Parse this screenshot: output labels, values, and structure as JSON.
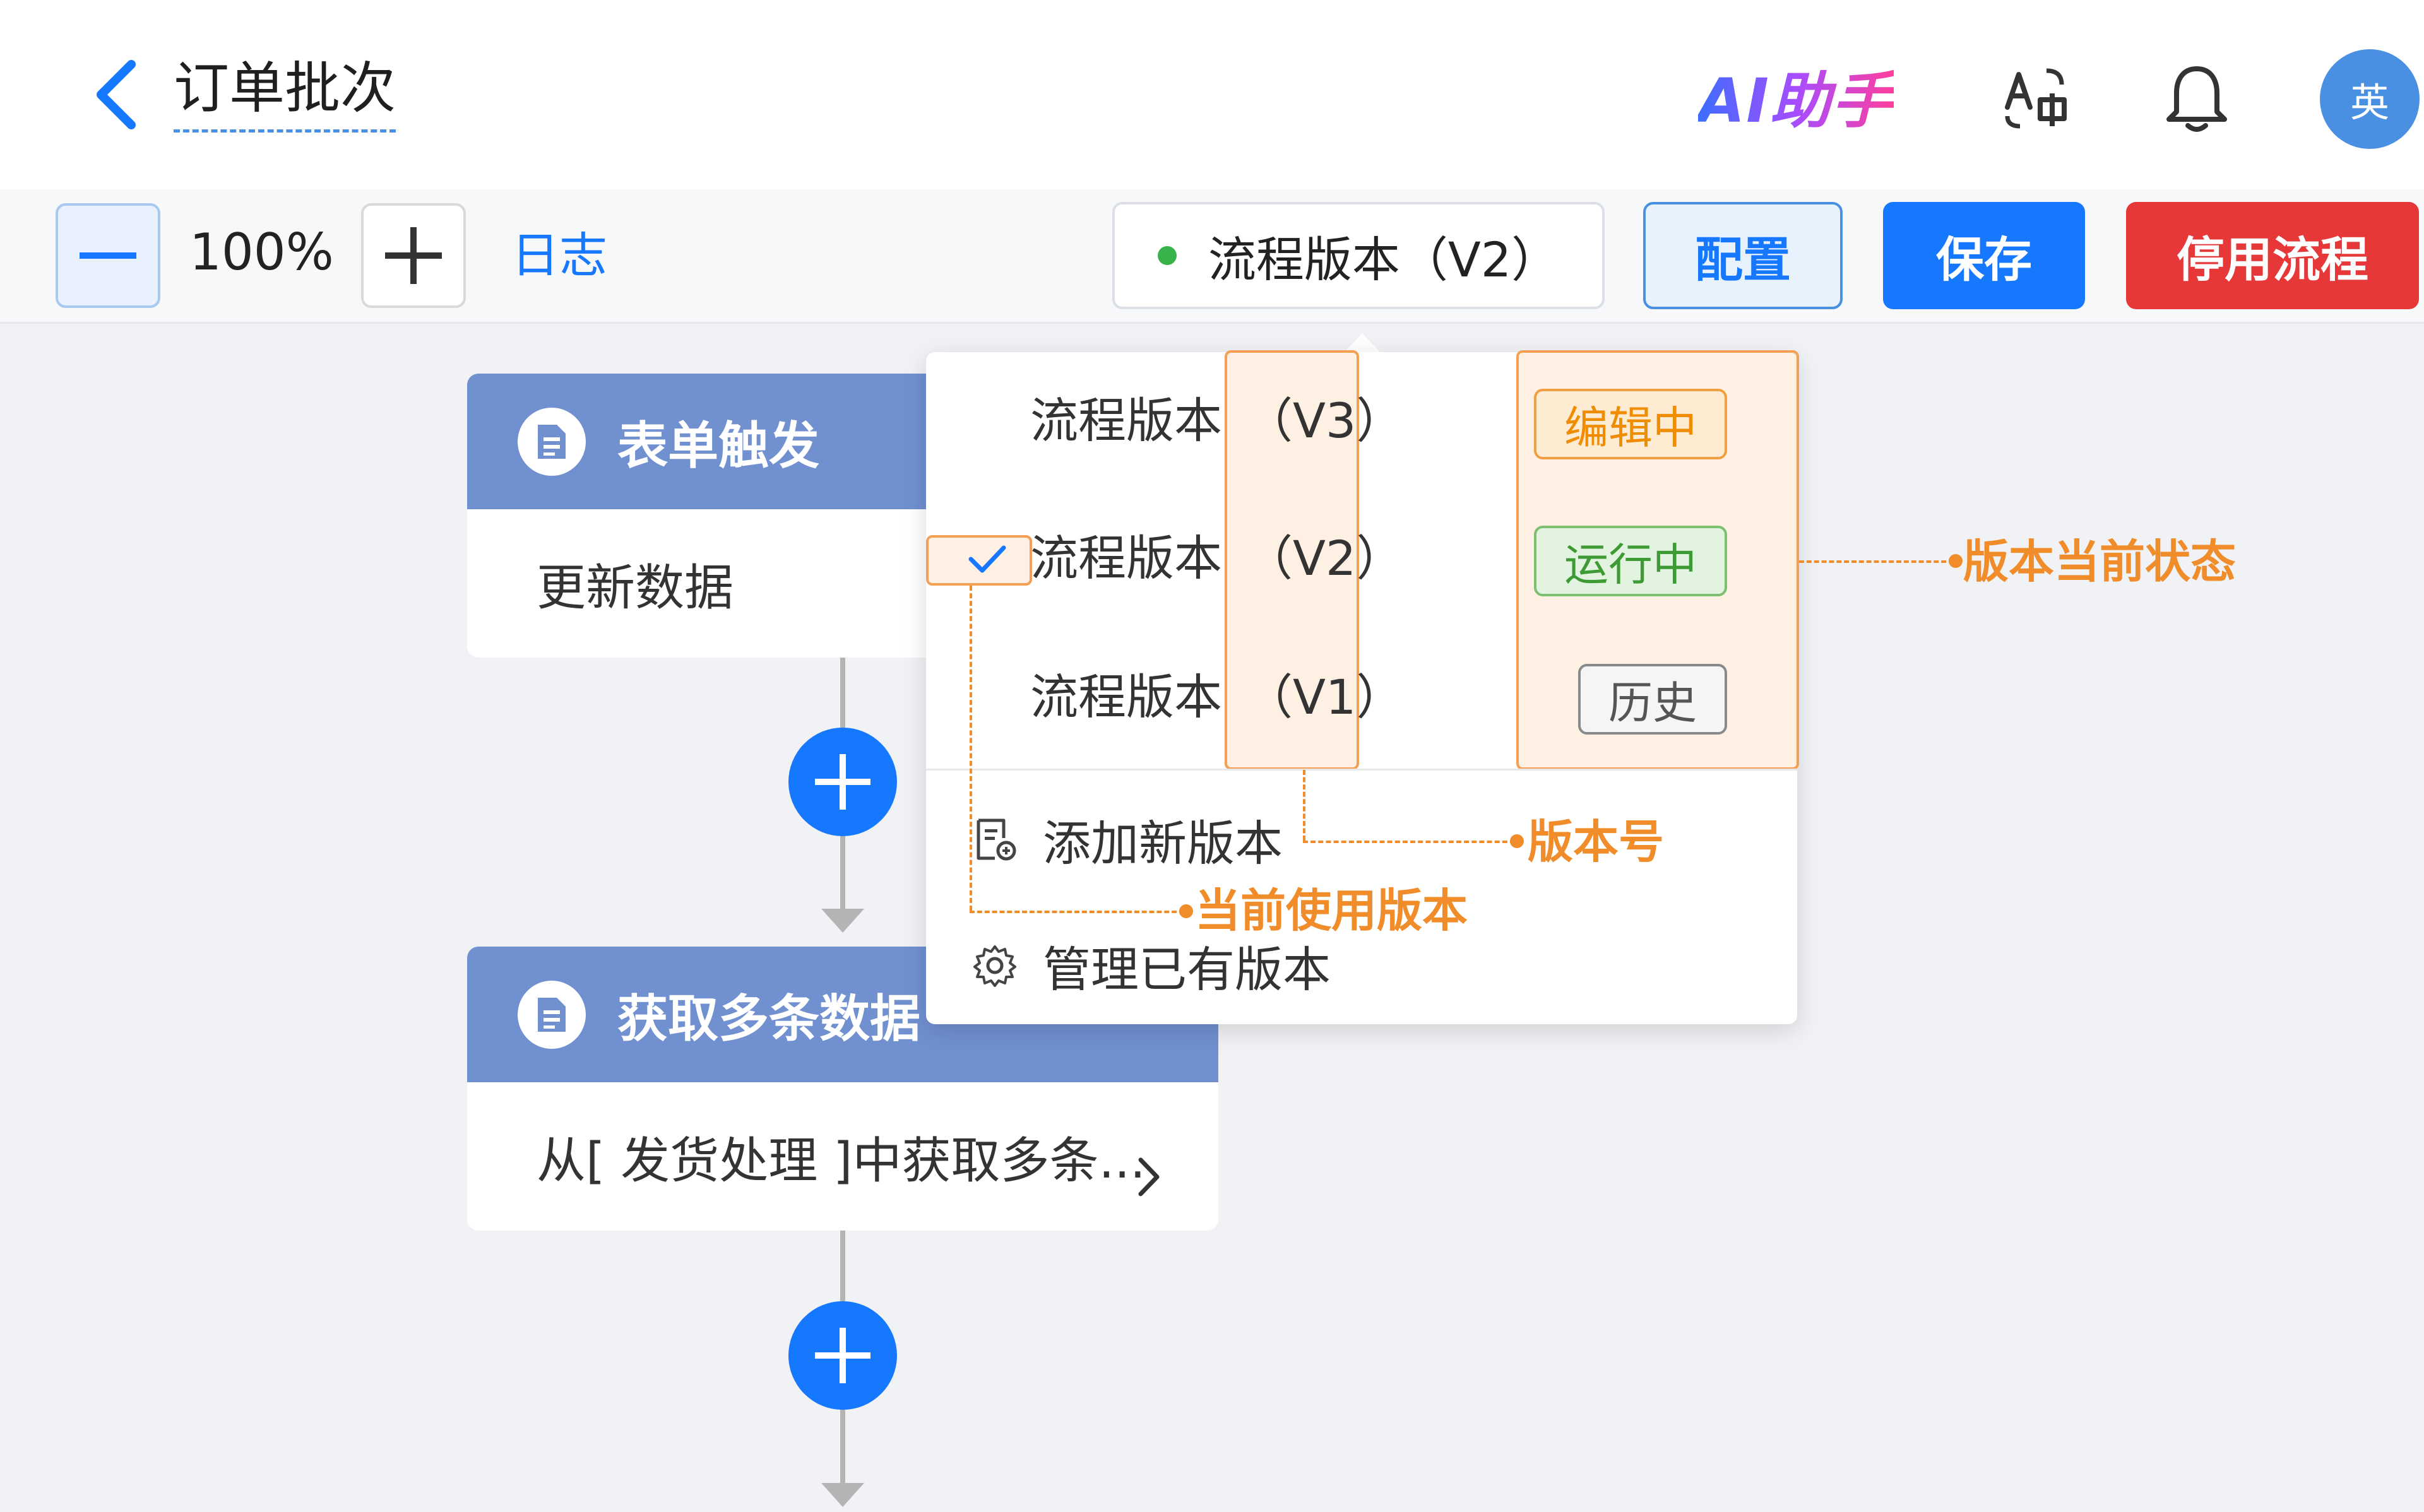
{
  "header": {
    "title": "订单批次",
    "ai_assistant": "AI助手",
    "avatar": "英"
  },
  "toolbar": {
    "zoom_level": "100%",
    "log_label": "日志",
    "version_select_label": "流程版本（V2）",
    "version_status_color": "#38b24a",
    "config_label": "配置",
    "save_label": "保存",
    "disable_label": "停用流程"
  },
  "flow": {
    "nodes": [
      {
        "title": "表单触发",
        "body": "更新数据",
        "icon": "document-icon"
      },
      {
        "title": "获取多条数据",
        "body": "从[ 发货处理 ]中获取多条...",
        "icon": "document-icon"
      }
    ]
  },
  "dropdown": {
    "versions": [
      {
        "name": "流程版本",
        "code": "（V3）",
        "status": "编辑中",
        "selected": false
      },
      {
        "name": "流程版本",
        "code": "（V2）",
        "status": "运行中",
        "selected": true
      },
      {
        "name": "流程版本",
        "code": "（V1）",
        "status": "历史",
        "selected": false
      }
    ],
    "actions": [
      {
        "label": "添加新版本",
        "icon": "add-version-icon"
      },
      {
        "label": "管理已有版本",
        "icon": "gear-icon"
      }
    ]
  },
  "annotations": {
    "status": "版本当前状态",
    "version_number": "版本号",
    "current_version": "当前使用版本"
  },
  "colors": {
    "primary": "#1677ff",
    "danger": "#e63838",
    "node_header": "#7090d0",
    "annotation": "#f08c2a"
  }
}
